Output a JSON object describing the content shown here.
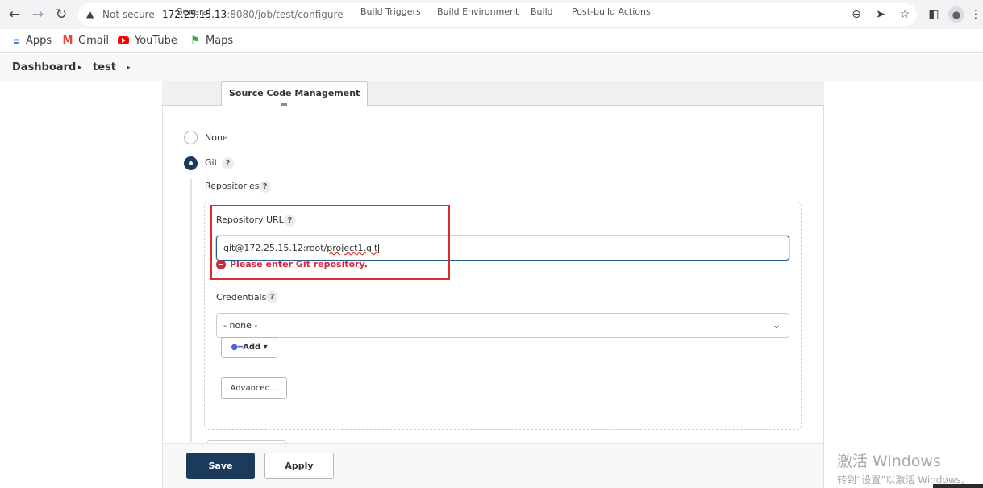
{
  "browser": {
    "back_icon": "arrow-left-icon",
    "forward_icon": "arrow-right-icon",
    "reload_icon": "reload-icon",
    "not_secure_label": "Not secure",
    "url_host": "172.25.15.13",
    "url_rest": ":8080/job/test/configure"
  },
  "bookmarks": {
    "items": [
      {
        "label": "Apps",
        "icon": "apps-grid-icon"
      },
      {
        "label": "Gmail",
        "icon": "gmail-icon"
      },
      {
        "label": "YouTube",
        "icon": "youtube-icon"
      },
      {
        "label": "Maps",
        "icon": "maps-icon"
      }
    ]
  },
  "breadcrumb": {
    "items": [
      "Dashboard",
      "test"
    ]
  },
  "tabs": [
    {
      "label": "General"
    },
    {
      "label": "Source Code Management",
      "active": true
    },
    {
      "label": "Build Triggers"
    },
    {
      "label": "Build Environment"
    },
    {
      "label": "Build"
    },
    {
      "label": "Post-build Actions"
    }
  ],
  "scm": {
    "option_none": "None",
    "option_git": "Git",
    "selected": "Git",
    "help_glyph": "?",
    "repositories_label": "Repositories",
    "repo_url_label": "Repository URL",
    "repo_url_value_start": "git@172.25.15.12:root/",
    "repo_url_value_end": "project1.git",
    "repo_error": "Please enter Git repository.",
    "credentials_label": "Credentials",
    "credentials_value": "- none -",
    "add_label": "Add",
    "advanced_label": "Advanced..."
  },
  "actions": {
    "save_label": "Save",
    "apply_label": "Apply"
  },
  "watermark": {
    "line1": "激活 Windows",
    "line2": "转到“设置”以激活 Windows。"
  },
  "colors": {
    "primary": "#1b3a5c",
    "error": "#d3273e",
    "highlight_box": "#e0272a"
  }
}
